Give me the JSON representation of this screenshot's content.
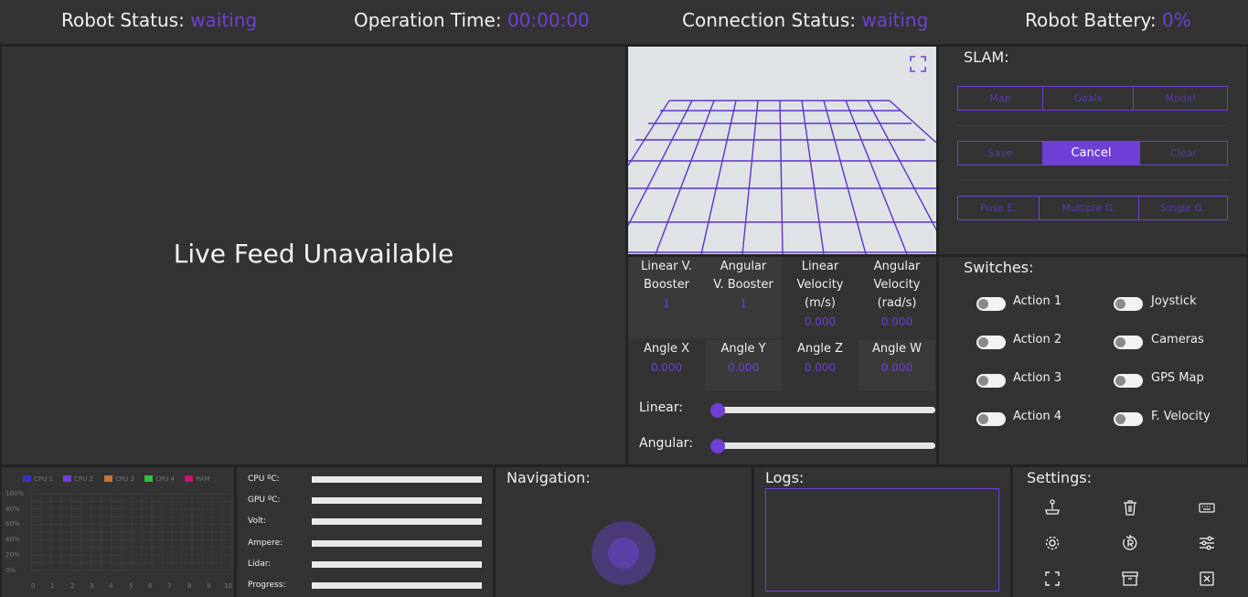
{
  "header": {
    "robot_status_label": "Robot Status:",
    "robot_status_value": "waiting",
    "operation_time_label": "Operation Time:",
    "operation_time_value": "00:00:00",
    "connection_status_label": "Connection Status:",
    "connection_status_value": "waiting",
    "battery_label": "Robot Battery:",
    "battery_value": "0%"
  },
  "live_feed": {
    "message": "Live Feed Unavailable"
  },
  "view3d": {
    "fullscreen_icon": "fullscreen-icon"
  },
  "slam": {
    "title": "SLAM:",
    "row1": [
      "Map",
      "Goals",
      "Model"
    ],
    "row2": [
      "Save",
      "Cancel",
      "Clear"
    ],
    "row2_active": "Cancel",
    "row3": [
      "Pose E.",
      "Multiple G.",
      "Single G."
    ]
  },
  "velocity": {
    "linear_booster_label1": "Linear V.",
    "linear_booster_label2": "Booster",
    "linear_booster_value": "1",
    "angular_booster_label1": "Angular",
    "angular_booster_label2": "V. Booster",
    "angular_booster_value": "1",
    "linear_velocity_label1": "Linear",
    "linear_velocity_label2": "Velocity",
    "linear_velocity_label3": "(m/s)",
    "linear_velocity_value": "0.000",
    "angular_velocity_label1": "Angular",
    "angular_velocity_label2": "Velocity",
    "angular_velocity_label3": "(rad/s)",
    "angular_velocity_value": "0.000",
    "angle_x_label": "Angle X",
    "angle_x_value": "0.000",
    "angle_y_label": "Angle Y",
    "angle_y_value": "0.000",
    "angle_z_label": "Angle Z",
    "angle_z_value": "0.000",
    "angle_w_label": "Angle W",
    "angle_w_value": "0.000",
    "linear_slider_label": "Linear:",
    "linear_slider_level": 0,
    "angular_slider_label": "Angular:",
    "angular_slider_level": 0
  },
  "switches": {
    "title": "Switches:",
    "items": [
      "Action 1",
      "Joystick",
      "Action 2",
      "Cameras",
      "Action 3",
      "GPS Map",
      "Action 4",
      "F. Velocity"
    ],
    "states": [
      false,
      false,
      false,
      false,
      false,
      false,
      false,
      false
    ]
  },
  "cpu_chart": {
    "legend": [
      "CPU 1",
      "CPU 2",
      "CPU 3",
      "CPU 4",
      "RAM"
    ],
    "legend_colors": [
      "#3a2fc9",
      "#6f3fd6",
      "#c8733a",
      "#2fbf3a",
      "#c8156f"
    ],
    "yticks": [
      "100%",
      "80%",
      "60%",
      "40%",
      "20%",
      "0%"
    ],
    "xticks": [
      "0",
      "1",
      "2",
      "3",
      "4",
      "5",
      "6",
      "7",
      "8",
      "9",
      "10"
    ]
  },
  "chart_data": {
    "type": "line",
    "series": [
      {
        "name": "CPU 1",
        "values": []
      },
      {
        "name": "CPU 2",
        "values": []
      },
      {
        "name": "CPU 3",
        "values": []
      },
      {
        "name": "CPU 4",
        "values": []
      },
      {
        "name": "RAM",
        "values": []
      }
    ],
    "x": [
      0,
      1,
      2,
      3,
      4,
      5,
      6,
      7,
      8,
      9,
      10
    ],
    "ylim": [
      0,
      100
    ],
    "xlim": [
      0,
      10
    ],
    "grid": true,
    "legend_position": "top"
  },
  "stats": {
    "labels": [
      "CPU ºC:",
      "GPU ºC:",
      "Volt:",
      "Ampere:",
      "Lidar:",
      "Progress:"
    ],
    "levels": [
      1,
      1,
      1,
      1,
      1,
      1
    ]
  },
  "navigation": {
    "title": "Navigation:"
  },
  "logs": {
    "title": "Logs:"
  },
  "settings": {
    "title": "Settings:",
    "icons": [
      "joystick-icon",
      "trash-icon",
      "keyboard-icon",
      "gear-icon",
      "reset-icon",
      "sliders-icon",
      "fullscreen-icon",
      "archive-icon",
      "close-box-icon"
    ]
  },
  "colors": {
    "accent": "#6f3fd6",
    "panel": "#333333",
    "background": "#232323"
  }
}
